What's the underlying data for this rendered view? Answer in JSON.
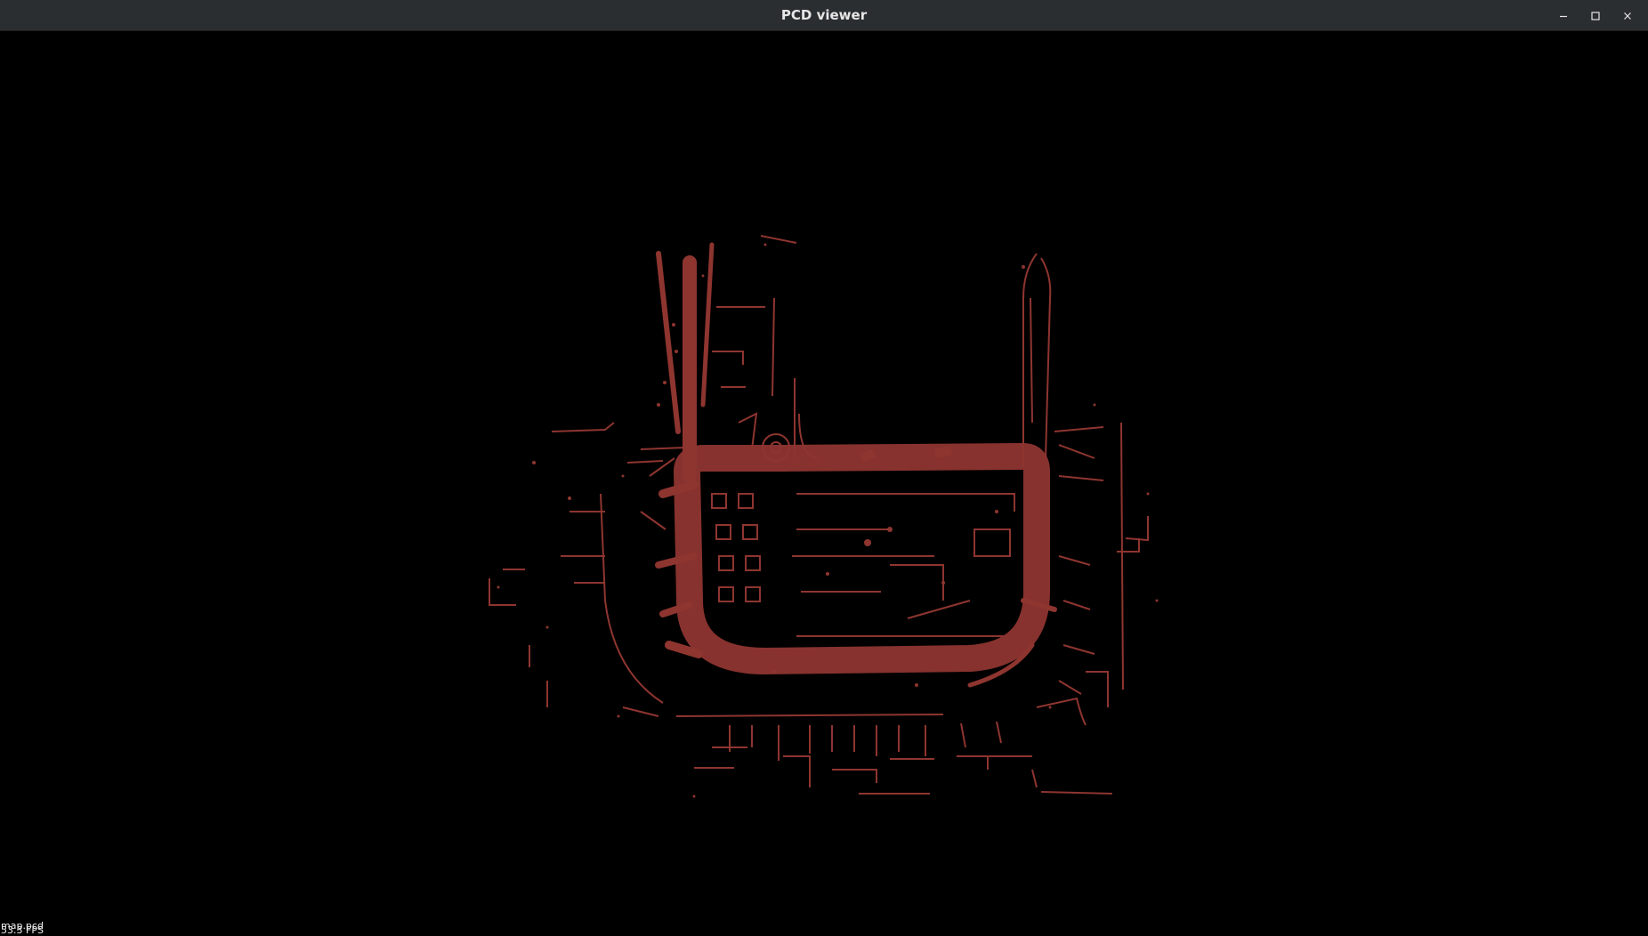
{
  "window": {
    "title": "PCD viewer"
  },
  "controls": [
    {
      "name": "minimize-icon"
    },
    {
      "name": "maximize-icon"
    },
    {
      "name": "close-icon"
    }
  ],
  "overlay": {
    "file": "map.pcd",
    "fps": "53.3 FPS"
  },
  "colors": {
    "titlebar": "#2b2e31",
    "background": "#000000",
    "point": "#8e3530"
  }
}
